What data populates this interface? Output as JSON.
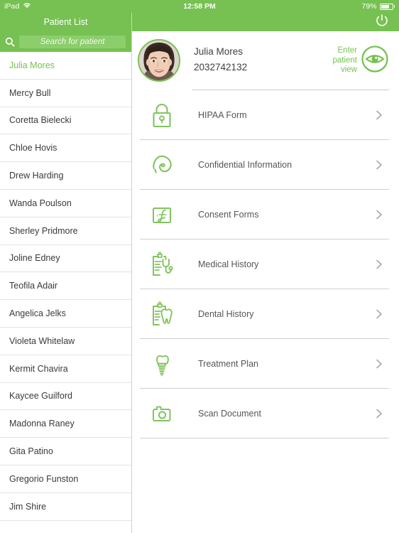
{
  "statusbar": {
    "device": "iPad",
    "wifi_icon": "wifi-icon",
    "time": "12:58 PM",
    "battery_percent": "79%",
    "battery_icon": "battery-icon"
  },
  "colors": {
    "brand_green": "#76c151",
    "search_field_green": "#8ccd6c",
    "label_gray": "#565656",
    "divider_gray": "#cfcfcf"
  },
  "sidebar": {
    "title": "Patient List",
    "search": {
      "icon": "search-icon",
      "placeholder": "Search for patient",
      "value": ""
    },
    "patients": [
      {
        "name": "Julia Mores",
        "selected": true
      },
      {
        "name": "Mercy Bull",
        "selected": false
      },
      {
        "name": "Coretta Bielecki",
        "selected": false
      },
      {
        "name": "Chloe Hovis",
        "selected": false
      },
      {
        "name": "Drew Harding",
        "selected": false
      },
      {
        "name": "Wanda Poulson",
        "selected": false
      },
      {
        "name": "Sherley Pridmore",
        "selected": false
      },
      {
        "name": "Joline Edney",
        "selected": false
      },
      {
        "name": "Teofila Adair",
        "selected": false
      },
      {
        "name": "Angelica Jelks",
        "selected": false
      },
      {
        "name": "Violeta Whitelaw",
        "selected": false
      },
      {
        "name": "Kermit Chavira",
        "selected": false
      },
      {
        "name": "Kaycee Guilford",
        "selected": false
      },
      {
        "name": "Madonna Raney",
        "selected": false
      },
      {
        "name": "Gita Patino",
        "selected": false
      },
      {
        "name": "Gregorio Funston",
        "selected": false
      },
      {
        "name": "Jim Shire",
        "selected": false
      }
    ]
  },
  "content": {
    "power_button_icon": "power-icon",
    "patient": {
      "avatar": "patient-photo",
      "name": "Julia Mores",
      "id": "2032742132"
    },
    "enter_patient_view": {
      "label": "Enter\npatient\nview",
      "icon": "eye-icon"
    },
    "menu": [
      {
        "label": "HIPAA Form",
        "icon": "lock-icon",
        "chevron": "chevron-right-icon"
      },
      {
        "label": "Confidential Information",
        "icon": "fingerprint-icon",
        "chevron": "chevron-right-icon"
      },
      {
        "label": "Consent Forms",
        "icon": "signature-icon",
        "chevron": "chevron-right-icon"
      },
      {
        "label": "Medical History",
        "icon": "clipboard-stethoscope-icon",
        "chevron": "chevron-right-icon"
      },
      {
        "label": "Dental History",
        "icon": "clipboard-tooth-icon",
        "chevron": "chevron-right-icon"
      },
      {
        "label": "Treatment Plan",
        "icon": "dental-implant-icon",
        "chevron": "chevron-right-icon"
      },
      {
        "label": "Scan Document",
        "icon": "camera-icon",
        "chevron": "chevron-right-icon"
      }
    ]
  }
}
